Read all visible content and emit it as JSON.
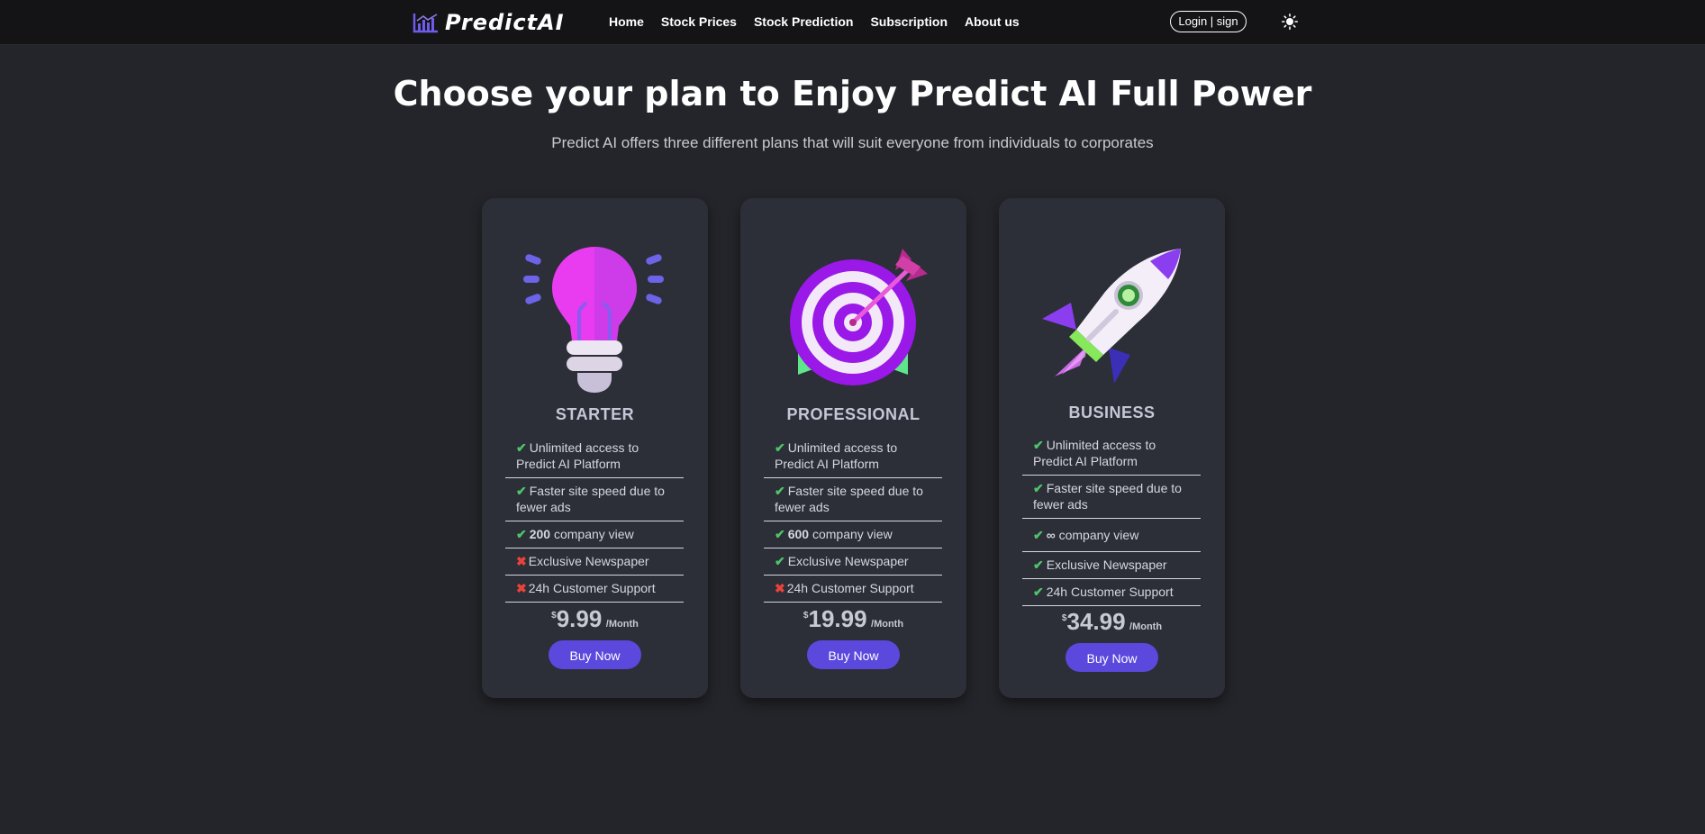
{
  "nav": {
    "brand": "PredictAI",
    "links": [
      "Home",
      "Stock Prices",
      "Stock Prediction",
      "Subscription",
      "About us"
    ],
    "login_label": "Login | sign"
  },
  "hero": {
    "title": "Choose your plan to Enjoy Predict AI Full Power",
    "subtitle": "Predict AI offers three different plans that will suit everyone from individuals to corporates"
  },
  "plans": [
    {
      "name": "STARTER",
      "illustration": "lightbulb-icon",
      "features": [
        {
          "included": true,
          "text": "Unlimited access to Predict AI Platform"
        },
        {
          "included": true,
          "text": "Faster site speed due to fewer ads"
        },
        {
          "included": true,
          "bold": "200",
          "text": " company view"
        },
        {
          "included": false,
          "text": "Exclusive Newspaper"
        },
        {
          "included": false,
          "text": "24h Customer Support"
        }
      ],
      "currency": "$",
      "price": "9.99",
      "period": "/Month",
      "button_label": "Buy Now"
    },
    {
      "name": "PROFESSIONAL",
      "illustration": "target-icon",
      "features": [
        {
          "included": true,
          "text": "Unlimited access to Predict AI Platform"
        },
        {
          "included": true,
          "text": "Faster site speed due to fewer ads"
        },
        {
          "included": true,
          "bold": "600",
          "text": " company view"
        },
        {
          "included": true,
          "text": "Exclusive Newspaper"
        },
        {
          "included": false,
          "text": "24h Customer Support"
        }
      ],
      "currency": "$",
      "price": "19.99",
      "period": "/Month",
      "button_label": "Buy Now"
    },
    {
      "name": "BUSINESS",
      "illustration": "rocket-icon",
      "features": [
        {
          "included": true,
          "text": "Unlimited access to Predict AI Platform"
        },
        {
          "included": true,
          "text": "Faster site speed due to fewer ads"
        },
        {
          "included": true,
          "bold": "∞",
          "text": " company view"
        },
        {
          "included": true,
          "text": "Exclusive Newspaper"
        },
        {
          "included": true,
          "text": "24h Customer Support"
        }
      ],
      "currency": "$",
      "price": "34.99",
      "period": "/Month",
      "button_label": "Buy Now"
    }
  ],
  "colors": {
    "background": "#24252a",
    "navbar": "#141416",
    "card": "#2c2e38",
    "accent": "#5b48dc",
    "check": "#4ec46a",
    "cross": "#e8433a"
  }
}
